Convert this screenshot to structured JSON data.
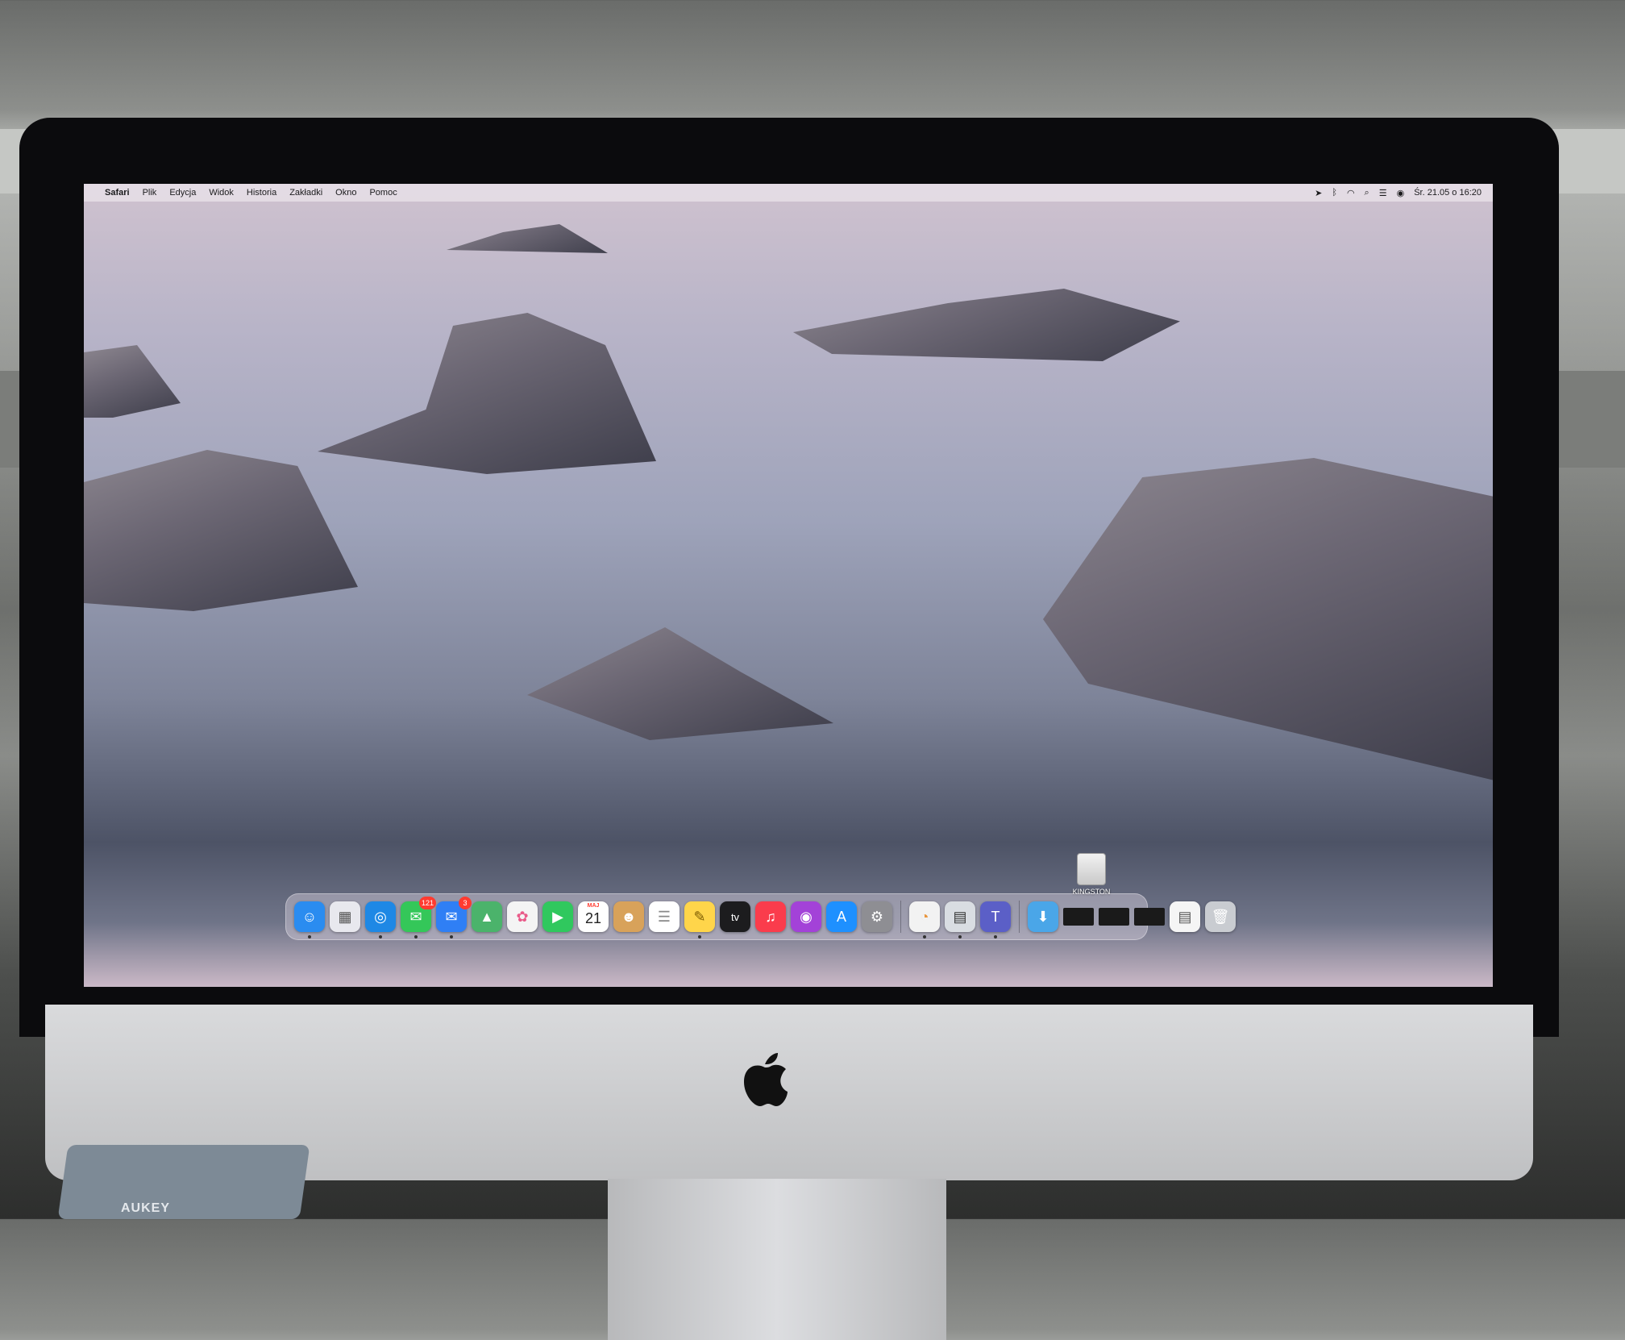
{
  "menubar": {
    "apple_glyph": "",
    "app_name": "Safari",
    "items": [
      "Plik",
      "Edycja",
      "Widok",
      "Historia",
      "Zakładki",
      "Okno",
      "Pomoc"
    ],
    "clock": "Śr. 21.05 o 16:20",
    "status_icons": [
      "location-icon",
      "bluetooth-icon",
      "wifi-icon",
      "search-icon",
      "control-center-icon",
      "siri-icon"
    ]
  },
  "desktop": {
    "drive_label": "KINGSTON"
  },
  "dock": {
    "apps": [
      {
        "name": "finder",
        "color": "#2a8cf0",
        "glyph": "☺"
      },
      {
        "name": "launchpad",
        "color": "#e8e8ee",
        "glyph": "▦"
      },
      {
        "name": "safari",
        "color": "#1e88e5",
        "glyph": "◎"
      },
      {
        "name": "messages",
        "color": "#34c759",
        "glyph": "✉",
        "badge": "121"
      },
      {
        "name": "mail",
        "color": "#2f7ff5",
        "glyph": "✉",
        "badge": "3"
      },
      {
        "name": "maps",
        "color": "#4bb36b",
        "glyph": "▲"
      },
      {
        "name": "photos",
        "color": "#f4f4f4",
        "glyph": "✿"
      },
      {
        "name": "facetime",
        "color": "#30c85e",
        "glyph": "▶"
      },
      {
        "name": "calendar",
        "color": "#ffffff",
        "month": "MAJ",
        "day": "21"
      },
      {
        "name": "contacts",
        "color": "#d8a25a",
        "glyph": "☻"
      },
      {
        "name": "reminders",
        "color": "#ffffff",
        "glyph": "☰"
      },
      {
        "name": "notes",
        "color": "#ffd54a",
        "glyph": "✎"
      },
      {
        "name": "apple-tv",
        "color": "#1c1c1e",
        "glyph": "tv"
      },
      {
        "name": "music",
        "color": "#fa3c4c",
        "glyph": "♫"
      },
      {
        "name": "podcasts",
        "color": "#a342d8",
        "glyph": "◉"
      },
      {
        "name": "app-store",
        "color": "#1e90ff",
        "glyph": "A"
      },
      {
        "name": "system-preferences",
        "color": "#8e8e93",
        "glyph": "⚙"
      },
      {
        "name": "color-app",
        "color": "#f2f2f2",
        "glyph": "◔"
      },
      {
        "name": "preview",
        "color": "#d9dde2",
        "glyph": "▤"
      },
      {
        "name": "teams",
        "color": "#5b5fc7",
        "glyph": "T"
      }
    ],
    "right_items": [
      {
        "name": "downloads-folder",
        "color": "#4aa6e8",
        "glyph": "⬇"
      },
      {
        "name": "minimized-window-1",
        "color": "#1a1a1a"
      },
      {
        "name": "minimized-window-2",
        "color": "#1a1a1a"
      },
      {
        "name": "minimized-window-3",
        "color": "#1a1a1a"
      },
      {
        "name": "minimized-document",
        "color": "#f5f5f5",
        "glyph": "▤"
      },
      {
        "name": "trash",
        "color": "#c9ccd1",
        "glyph": "🗑"
      }
    ]
  },
  "hardware": {
    "hub_brand": "AUKEY"
  }
}
